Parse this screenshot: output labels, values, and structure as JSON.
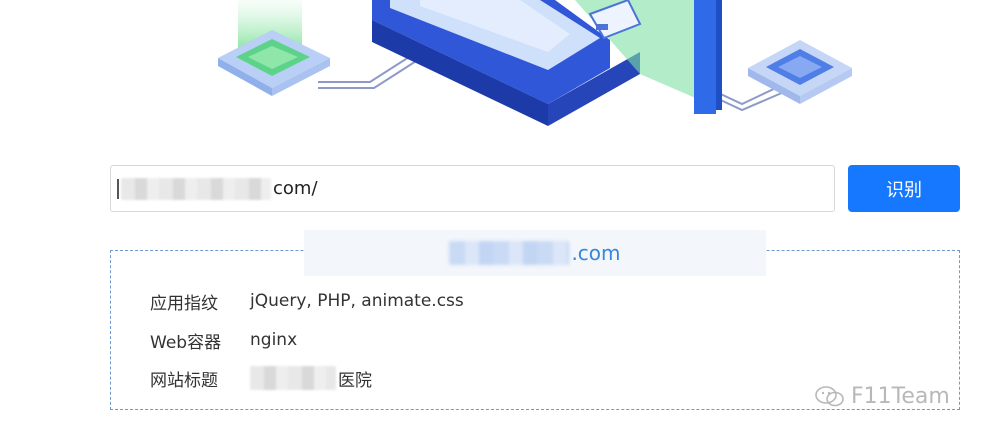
{
  "search": {
    "url_suffix": "com/",
    "button_label": "识别"
  },
  "result": {
    "domain_suffix": ".com",
    "rows": [
      {
        "label": "应用指纹",
        "value": "jQuery, PHP, animate.css"
      },
      {
        "label": "Web容器",
        "value": "nginx"
      },
      {
        "label": "网站标题",
        "value_suffix": "医院"
      }
    ]
  },
  "watermark": {
    "text": "F11Team"
  },
  "colors": {
    "accent": "#1677ff",
    "panel_border": "#6d9bd1",
    "domain_text": "#3a86d8"
  }
}
